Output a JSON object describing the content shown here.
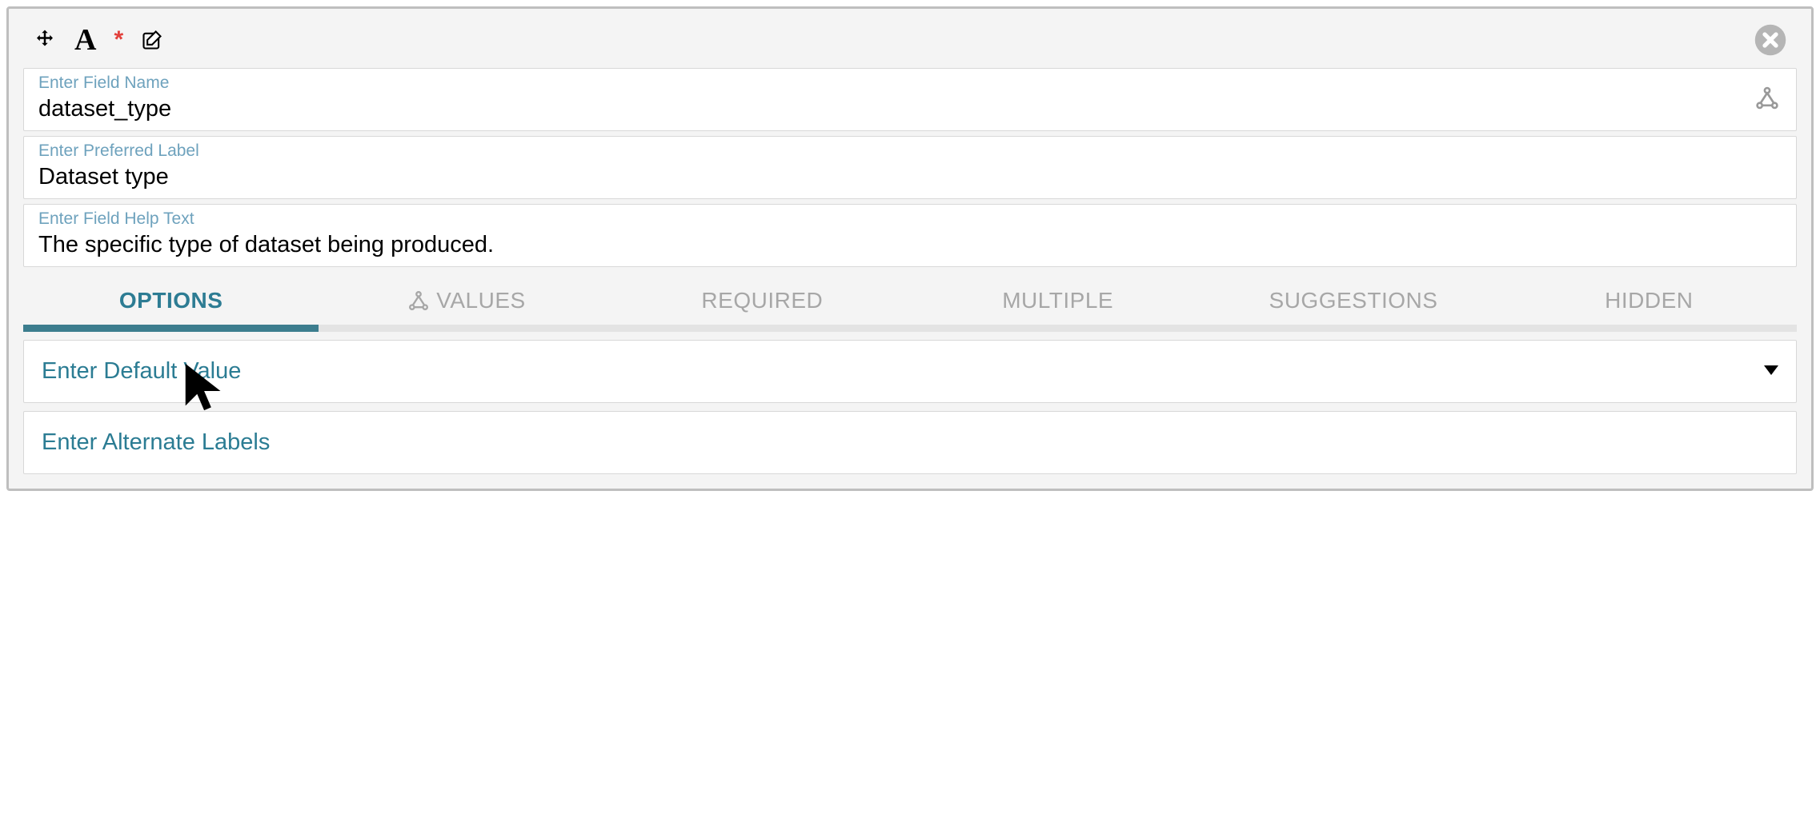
{
  "header": {
    "icons": {
      "move": "move-icon",
      "font": "A",
      "asterisk": "*",
      "edit": "edit-icon"
    },
    "close": "close-icon"
  },
  "fields": {
    "fieldName": {
      "label": "Enter Field Name",
      "value": "dataset_type",
      "hasGraphIcon": true
    },
    "preferredLabel": {
      "label": "Enter Preferred Label",
      "value": "Dataset type"
    },
    "helpText": {
      "label": "Enter Field Help Text",
      "value": "The specific type of dataset being produced."
    }
  },
  "tabs": [
    {
      "id": "options",
      "label": "OPTIONS",
      "active": true,
      "icon": null
    },
    {
      "id": "values",
      "label": "VALUES",
      "active": false,
      "icon": "graph"
    },
    {
      "id": "required",
      "label": "REQUIRED",
      "active": false,
      "icon": null
    },
    {
      "id": "multiple",
      "label": "MULTIPLE",
      "active": false,
      "icon": null
    },
    {
      "id": "suggestions",
      "label": "SUGGESTIONS",
      "active": false,
      "icon": null
    },
    {
      "id": "hidden",
      "label": "HIDDEN",
      "active": false,
      "icon": null
    }
  ],
  "options": {
    "defaultValue": {
      "placeholder": "Enter Default Value",
      "hasDropdown": true
    },
    "alternateLabels": {
      "placeholder": "Enter Alternate Labels",
      "hasDropdown": false
    }
  }
}
